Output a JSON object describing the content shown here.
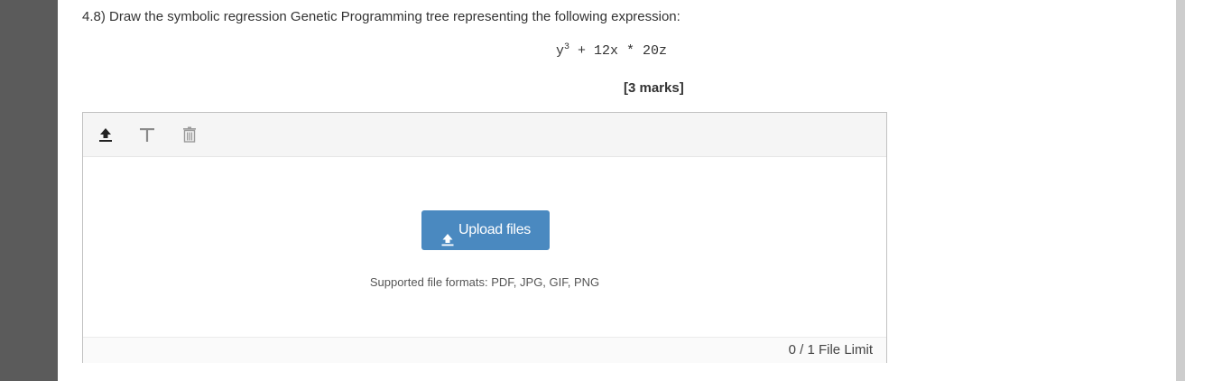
{
  "question": {
    "text": "4.8) Draw the symbolic regression Genetic Programming tree representing the following expression:",
    "expression": {
      "base": "y",
      "exponent": "3",
      "rest": " + 12x * 20z"
    },
    "marks": "[3 marks]"
  },
  "upload_widget": {
    "toolbar": [
      {
        "name": "upload-icon"
      },
      {
        "name": "text-icon"
      },
      {
        "name": "trash-icon"
      }
    ],
    "upload_button_label": "Upload files",
    "supported_formats": "Supported file formats: PDF, JPG, GIF, PNG",
    "file_limit": "0 / 1 File Limit"
  },
  "colors": {
    "accent": "#4a89c0",
    "left_gutter": "#5b5b5b",
    "toolbar_bg": "#f5f5f5"
  }
}
